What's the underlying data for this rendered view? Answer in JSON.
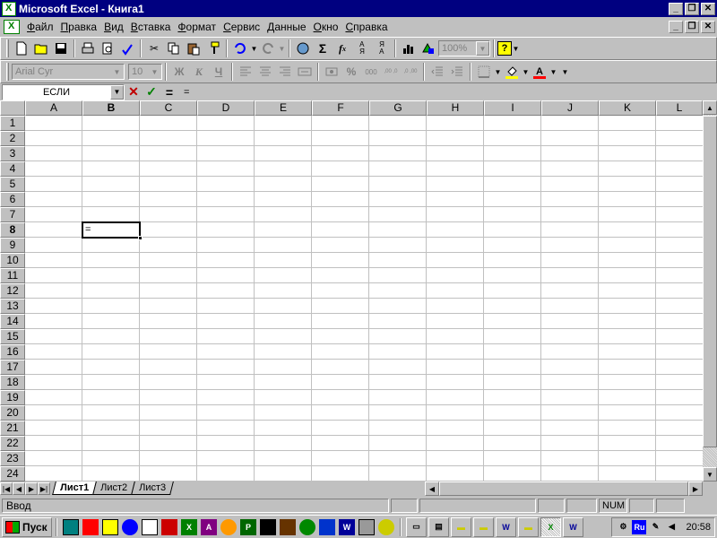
{
  "window": {
    "title": "Microsoft Excel - Книга1"
  },
  "menu": {
    "items": [
      "Файл",
      "Правка",
      "Вид",
      "Вставка",
      "Формат",
      "Сервис",
      "Данные",
      "Окно",
      "Справка"
    ]
  },
  "toolbar_standard": {
    "zoom": "100%"
  },
  "toolbar_format": {
    "font_name": "Arial Cyr",
    "font_size": "10",
    "bold": "Ж",
    "italic": "К",
    "underline": "Ч",
    "percent": "%",
    "thousands": "000",
    "inc_decimal": ",00 ,0",
    "dec_decimal": ",0 ,00"
  },
  "formula_bar": {
    "name_box": "ЕСЛИ",
    "equals_btn": "=",
    "content": "="
  },
  "columns": [
    "A",
    "B",
    "C",
    "D",
    "E",
    "F",
    "G",
    "H",
    "I",
    "J",
    "K",
    "L"
  ],
  "rows": [
    "1",
    "2",
    "3",
    "4",
    "5",
    "6",
    "7",
    "8",
    "9",
    "10",
    "11",
    "12",
    "13",
    "14",
    "15",
    "16",
    "17",
    "18",
    "19",
    "20",
    "21",
    "22",
    "23",
    "24"
  ],
  "active_cell": {
    "col": "B",
    "row": "8",
    "content": "="
  },
  "sheets": [
    "Лист1",
    "Лист2",
    "Лист3"
  ],
  "status": {
    "mode": "Ввод",
    "num": "NUM"
  },
  "taskbar": {
    "start_label": "Пуск",
    "lang": "Ru",
    "clock": "20:58"
  },
  "colors": {
    "title_bar": "#000080",
    "face": "#c0c0c0",
    "grid": "#c0c0c0"
  }
}
